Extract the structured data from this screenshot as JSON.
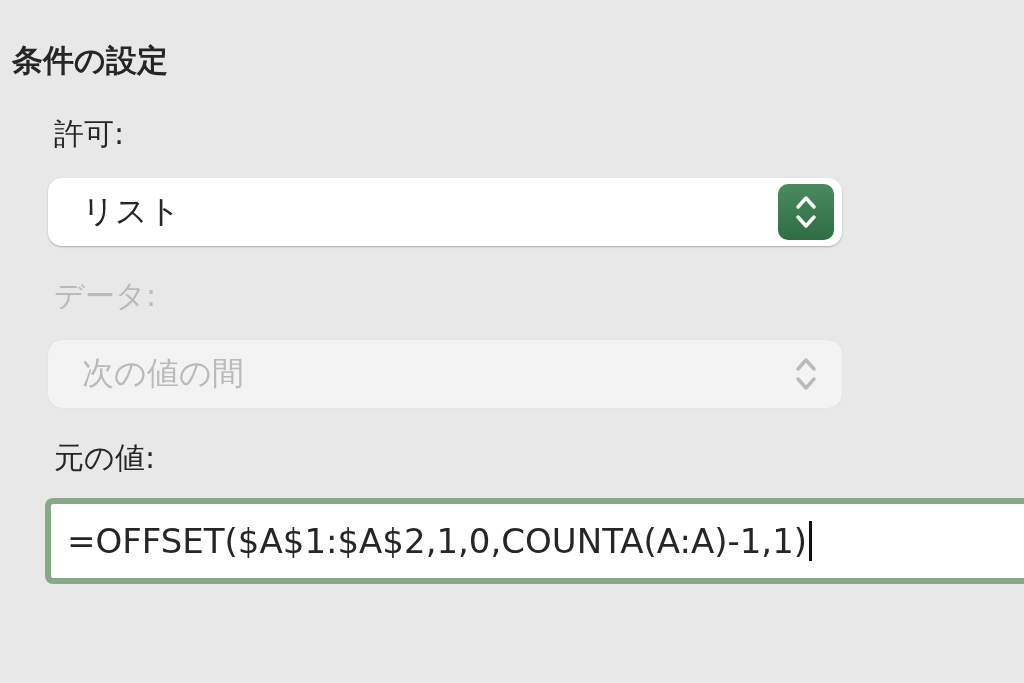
{
  "section_title": "条件の設定",
  "fields": [
    {
      "kind": "select",
      "label": "許可:",
      "value": "リスト",
      "disabled": false
    },
    {
      "kind": "select",
      "label": "データ:",
      "value": "次の値の間",
      "disabled": true
    },
    {
      "kind": "text",
      "label": "元の値:",
      "value": "=OFFSET($A$1:$A$2,1,0,COUNTA(A:A)-1,1)",
      "focused": true
    }
  ]
}
